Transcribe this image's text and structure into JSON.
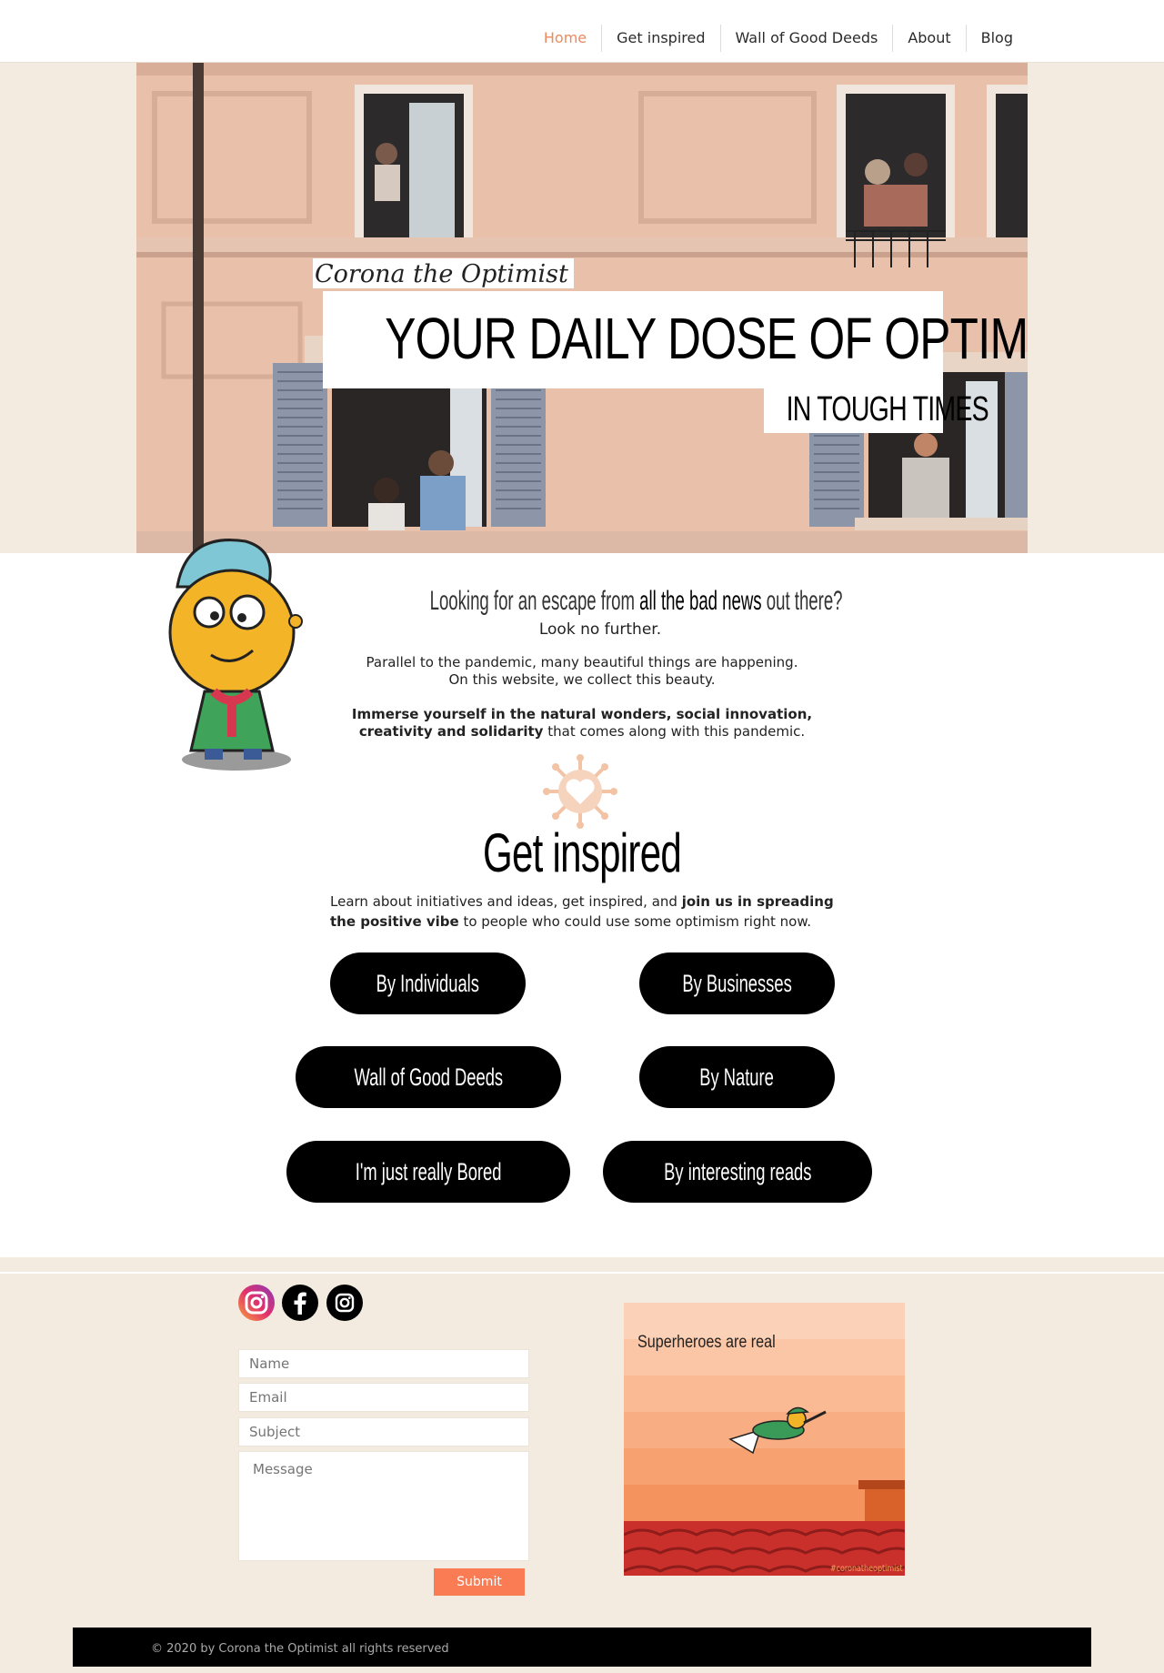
{
  "nav": {
    "items": [
      {
        "label": "Home",
        "active": true
      },
      {
        "label": "Get inspired",
        "active": false
      },
      {
        "label": "Wall of Good Deeds",
        "active": false
      },
      {
        "label": "About",
        "active": false
      },
      {
        "label": "Blog",
        "active": false
      }
    ]
  },
  "hero": {
    "subtitle": "Corona the Optimist",
    "title": "Your daily dose of optimism",
    "tagline": "In tough times"
  },
  "intro": {
    "heading_part1": "Looking for an escape from ",
    "heading_bold": "all the bad news",
    "heading_part2": " out there?",
    "subheading": "Look no further.",
    "paragraph1_line1": "Parallel to the pandemic, many beautiful things are happening.",
    "paragraph1_line2": "On this website, we collect this beauty.",
    "paragraph2_bold1": "Immerse yourself in the natural wonders, social innovation,",
    "paragraph2_bold2": "creativity and solidarity",
    "paragraph2_rest": " that comes along with this pandemic."
  },
  "get_inspired": {
    "title": "Get inspired",
    "text_part1": "Learn about initiatives and ideas, get inspired, and ",
    "text_bold": "join us in spreading the positive vibe",
    "text_part2": " to people who could use some optimism right now."
  },
  "buttons": {
    "individuals": "By Individuals",
    "businesses": "By Businesses",
    "wall": "Wall of Good Deeds",
    "nature": "By Nature",
    "bored": "I'm just really Bored",
    "reads": "By interesting reads"
  },
  "social": [
    "instagram-color-icon",
    "facebook-icon",
    "instagram-icon"
  ],
  "form": {
    "name_placeholder": "Name",
    "email_placeholder": "Email",
    "subject_placeholder": "Subject",
    "message_placeholder": "Message",
    "submit_label": "Submit"
  },
  "promo": {
    "caption": "Superheroes are real",
    "hashtag": "#coronatheoptimist"
  },
  "footer": {
    "copyright": "© 2020 by Corona the Optimist all rights reserved"
  },
  "colors": {
    "accent": "#ee8a5d",
    "submit": "#f97c55",
    "beige": "#f3ebe0"
  }
}
